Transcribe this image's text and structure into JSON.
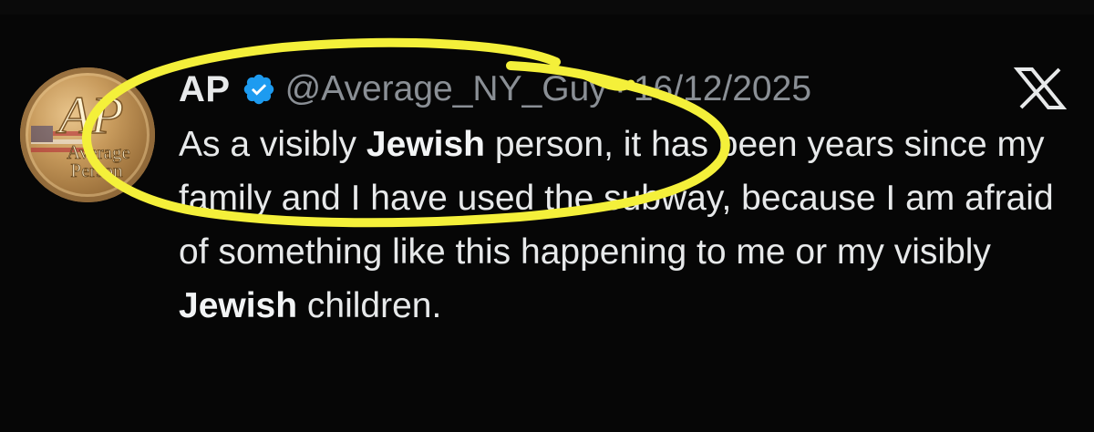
{
  "tweet": {
    "author": {
      "display_name": "AP",
      "handle": "@Average_NY_Guy",
      "verified": true,
      "avatar_text": [
        "Average",
        "Person"
      ],
      "avatar_monogram": "AP"
    },
    "separator": "·",
    "date": "16/12/2025",
    "text_segments": [
      {
        "text": "As a visibly ",
        "bold": false
      },
      {
        "text": "Jewish",
        "bold": true
      },
      {
        "text": " person, it has been years since my family and I have used the subway, because I am afraid of something like this happening to me or my visibly ",
        "bold": false
      },
      {
        "text": "Jewish",
        "bold": true
      },
      {
        "text": " children.",
        "bold": false
      }
    ]
  },
  "platform_logo": "X",
  "colors": {
    "background": "#060606",
    "text": "#e7e9ea",
    "muted": "#8a8f95",
    "verified_blue": "#1d9bf0",
    "highlight": "#f4f03a"
  },
  "icons": {
    "verified": "verified-badge-icon",
    "platform": "x-logo-icon"
  }
}
